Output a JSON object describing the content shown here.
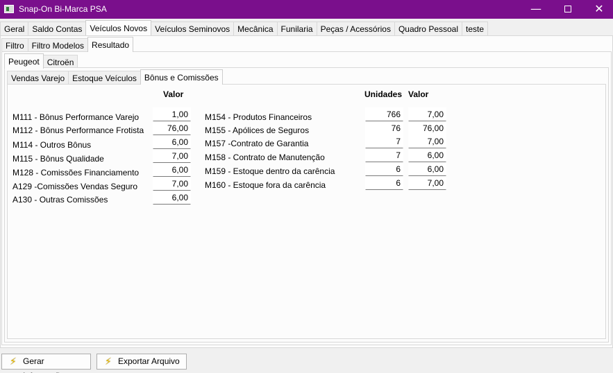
{
  "window": {
    "title": "Snap-On Bi-Marca PSA",
    "minimize_glyph": "—",
    "close_glyph": "✕"
  },
  "main_tabs": [
    "Geral",
    "Saldo Contas",
    "Veículos Novos",
    "Veículos Seminovos",
    "Mecânica",
    "Funilaria",
    "Peças / Acessórios",
    "Quadro Pessoal",
    "teste"
  ],
  "sub_tabs": [
    "Filtro",
    "Filtro Modelos",
    "Resultado"
  ],
  "brand_tabs": [
    "Peugeot",
    "Citroën"
  ],
  "section_tabs": [
    "Vendas Varejo",
    "Estoque Veículos",
    "Bônus e Comissões"
  ],
  "left_table": {
    "header_valor": "Valor",
    "rows": [
      {
        "label": "M111 - Bônus Performance Varejo",
        "valor": "1,00"
      },
      {
        "label": "M112 - Bônus Performance Frotista",
        "valor": "76,00"
      },
      {
        "label": "M114 - Outros Bônus",
        "valor": "6,00"
      },
      {
        "label": "M115 - Bônus Qualidade",
        "valor": "7,00"
      },
      {
        "label": "M128 - Comissões Financiamento",
        "valor": "6,00"
      },
      {
        "label": "A129 -Comissões Vendas Seguro",
        "valor": "7,00"
      },
      {
        "label": "A130 - Outras Comissões",
        "valor": "6,00"
      }
    ]
  },
  "right_table": {
    "header_unidades": "Unidades",
    "header_valor": "Valor",
    "rows": [
      {
        "label": "M154 - Produtos Financeiros",
        "unidades": "766",
        "valor": "7,00"
      },
      {
        "label": "M155 - Apólices de Seguros",
        "unidades": "76",
        "valor": "76,00"
      },
      {
        "label": "M157 -Contrato de Garantia",
        "unidades": "7",
        "valor": "7,00"
      },
      {
        "label": "M158 - Contrato de Manutenção",
        "unidades": "7",
        "valor": "6,00"
      },
      {
        "label": "M159 - Estoque dentro da carência",
        "unidades": "6",
        "valor": "6,00"
      },
      {
        "label": "M160 - Estoque fora da carência",
        "unidades": "6",
        "valor": "7,00"
      }
    ]
  },
  "footer": {
    "gerar_label": "Gerar Informações",
    "exportar_label": "Exportar Arquivo",
    "bolt_glyph": "⚡"
  },
  "colors": {
    "titlebar": "#7a0f8c",
    "panel_bg": "#fcfcfc",
    "window_bg": "#f0f0f0"
  }
}
